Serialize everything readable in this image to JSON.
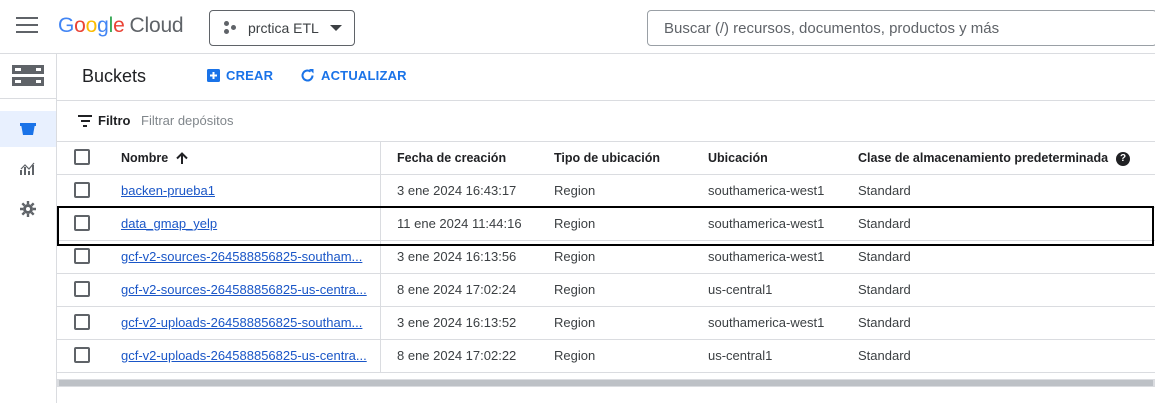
{
  "header": {
    "logo": {
      "google": [
        "G",
        "o",
        "o",
        "g",
        "l",
        "e"
      ],
      "cloud": "Cloud"
    },
    "project": "prctica ETL",
    "search_placeholder": "Buscar (/) recursos, documentos, productos y más"
  },
  "rail": {
    "items": [
      {
        "icon": "storage-icon"
      },
      {
        "icon": "bucket-icon",
        "active": true
      },
      {
        "icon": "monitoring-icon"
      },
      {
        "icon": "settings-icon"
      }
    ]
  },
  "page": {
    "title": "Buckets",
    "create_label": "CREAR",
    "refresh_label": "ACTUALIZAR"
  },
  "filter": {
    "label": "Filtro",
    "placeholder": "Filtrar depósitos"
  },
  "table": {
    "columns": {
      "name": "Nombre",
      "created": "Fecha de creación",
      "location_type": "Tipo de ubicación",
      "location": "Ubicación",
      "storage_class": "Clase de almacenamiento predeterminada"
    },
    "rows": [
      {
        "name": "backen-prueba1",
        "created": "3 ene 2024 16:43:17",
        "location_type": "Region",
        "location": "southamerica-west1",
        "storage_class": "Standard"
      },
      {
        "name": "data_gmap_yelp",
        "created": "11 ene 2024 11:44:16",
        "location_type": "Region",
        "location": "southamerica-west1",
        "storage_class": "Standard"
      },
      {
        "name": "gcf-v2-sources-264588856825-southam...",
        "created": "3 ene 2024 16:13:56",
        "location_type": "Region",
        "location": "southamerica-west1",
        "storage_class": "Standard"
      },
      {
        "name": "gcf-v2-sources-264588856825-us-centra...",
        "created": "8 ene 2024 17:02:24",
        "location_type": "Region",
        "location": "us-central1",
        "storage_class": "Standard"
      },
      {
        "name": "gcf-v2-uploads-264588856825-southam...",
        "created": "3 ene 2024 16:13:52",
        "location_type": "Region",
        "location": "southamerica-west1",
        "storage_class": "Standard"
      },
      {
        "name": "gcf-v2-uploads-264588856825-us-centra...",
        "created": "8 ene 2024 17:02:22",
        "location_type": "Region",
        "location": "us-central1",
        "storage_class": "Standard"
      }
    ]
  },
  "colors": {
    "accent": "#1a73e8",
    "active_rail": "#e8f0fe",
    "border": "#dadce0"
  }
}
